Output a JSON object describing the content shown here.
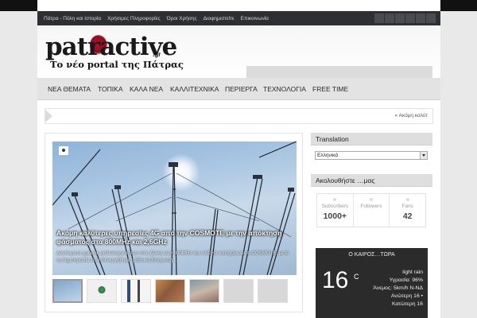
{
  "topnav": {
    "items": [
      "Πάτρα - Πόλη και Ιστορία",
      "Χρήσιμες Πληροφορίες",
      "Όροι Χρήσης",
      "Διαφημιστείτε",
      "Επικοινωνία"
    ]
  },
  "logo": {
    "name": "patractive",
    "tld": ".gr",
    "tagline": "Το νέο portal της Πάτρας"
  },
  "mainnav": {
    "items": [
      "ΝΕΑ ΘΕΜΑΤΑ",
      "ΤΟΠΙΚΑ",
      "ΚΑΛΑ ΝΕΑ",
      "ΚΑΛΛΙΤΕΧΝΙΚΑ",
      "ΠΕΡΙΕΡΓΑ",
      "ΤΕΧΝΟΛΟΓΙΑ",
      "FREE TIME"
    ]
  },
  "ticker": {
    "text": "« Ακόμη καλύτ"
  },
  "slider": {
    "title": "Ακόμη καλύτερες υπηρεσίες 4G από την COSMOTE με την απόκτηση φάσματος στα 800MHz και 2,6GHz",
    "excerpt": "Δικαίωματα χρήσης ραδιοσυχνοτήτων στις ζώνες των 800MHz και 2,6GHz κατοχύρωσε η COSMOTE, μετά τη δημοπρασία που διενεργήθηκε η Εθνική Επιτροπή ..."
  },
  "translation": {
    "heading": "Translation",
    "selected": "Ελληνικά"
  },
  "follow": {
    "heading": "Ακολουθήστε …μας",
    "counters": [
      {
        "label": "Subscribers",
        "value": "1000+"
      },
      {
        "label": "Followers",
        "value": ""
      },
      {
        "label": "Fans",
        "value": "42"
      }
    ]
  },
  "weather": {
    "title": "Ο ΚΑΙΡΟΣ…ΤΩΡΑ",
    "temp": "16",
    "unit": "C",
    "condition": "light rain",
    "humidity": "Υγρασία: 96%",
    "wind": "Άνεμος: 5km/h N-ΝΔ",
    "high": "Ανώτερη 16 •",
    "low": "Κατώτερη 16"
  },
  "colors": {
    "topbar": "#2d2f33",
    "nav": "#e3e3e3",
    "weather_bg": "#2b2b2b",
    "logo_accent": "#b3122a"
  }
}
